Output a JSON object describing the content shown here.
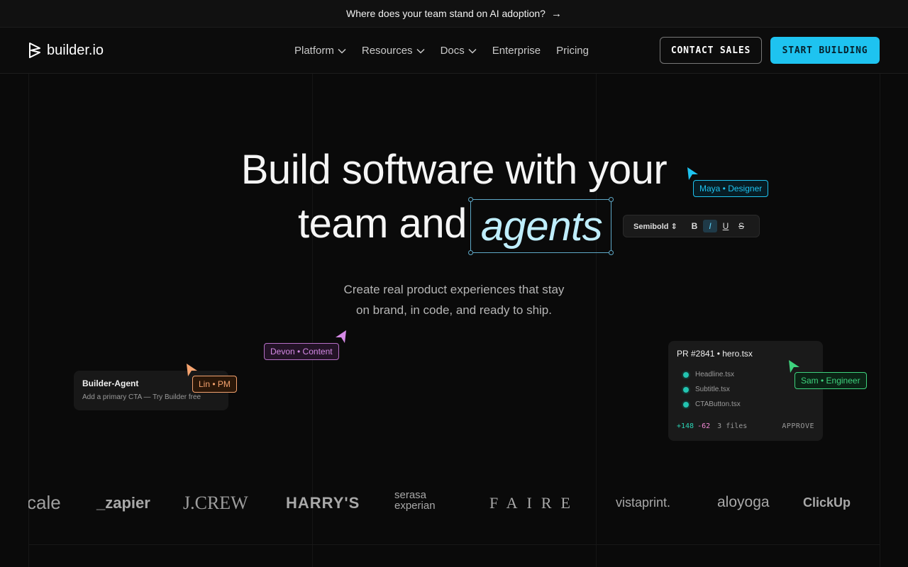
{
  "announcement": {
    "text": "Where does your team stand on AI adoption?",
    "arrow": "→"
  },
  "nav": {
    "logo_text": "builder.io",
    "menu": [
      {
        "label": "Platform",
        "dropdown": true
      },
      {
        "label": "Resources",
        "dropdown": true
      },
      {
        "label": "Docs",
        "dropdown": true
      },
      {
        "label": "Enterprise",
        "dropdown": false
      },
      {
        "label": "Pricing",
        "dropdown": false
      }
    ],
    "contact_label": "CONTACT SALES",
    "start_label": "START BUILDING"
  },
  "hero": {
    "line1": "Build software with your",
    "line2": "team and",
    "highlight": "agents",
    "subtitle_line1": "Create real product experiences that stay",
    "subtitle_line2": "on brand, in code, and ready to ship."
  },
  "toolbar": {
    "font_weight": "Semibold ⇕",
    "bold": "B",
    "italic": "I",
    "underline": "U",
    "strike": "S"
  },
  "collaborators": {
    "maya": {
      "label": "Maya • Designer",
      "color": "#1ec3f0"
    },
    "devon": {
      "label": "Devon • Content",
      "color": "#d58ae6"
    },
    "lin": {
      "label": "Lin • PM",
      "color": "#f5a36f"
    },
    "sam": {
      "label": "Sam • Engineer",
      "color": "#3ed27d"
    }
  },
  "agent_card": {
    "title": "Builder-Agent",
    "message": "Add a primary CTA — Try Builder free"
  },
  "pr_card": {
    "title": "PR #2841 • hero.tsx",
    "files": [
      "Headline.tsx",
      "Subtitle.tsx",
      "CTAButton.tsx"
    ],
    "additions": "+148",
    "deletions": "-62",
    "file_count": "3 files",
    "approve_label": "APPROVE"
  },
  "logos": [
    "cale",
    "_zapier",
    "J.CREW",
    "HARRY'S",
    "serasa experian",
    "FAIRE",
    "vistaprint.",
    "aloyoga",
    "ClickUp"
  ],
  "colors": {
    "accent": "#1ec3f0",
    "background": "#0a0a0a"
  }
}
